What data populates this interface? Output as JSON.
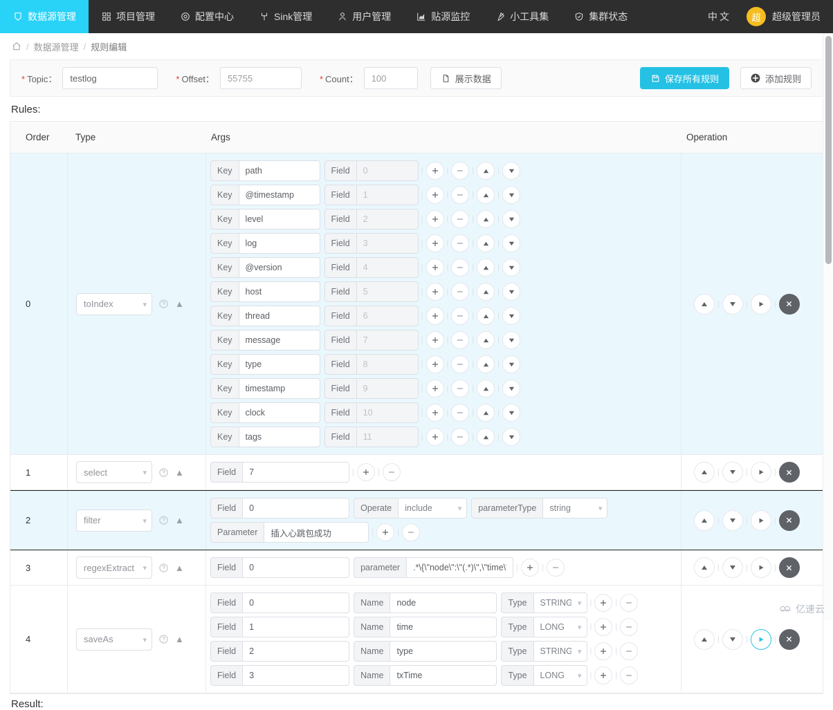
{
  "navbar": {
    "items": [
      {
        "label": "数据源管理",
        "icon": "database-icon",
        "active": true
      },
      {
        "label": "项目管理",
        "icon": "grid-icon",
        "active": false
      },
      {
        "label": "配置中心",
        "icon": "target-icon",
        "active": false
      },
      {
        "label": "Sink管理",
        "icon": "fork-icon",
        "active": false
      },
      {
        "label": "用户管理",
        "icon": "user-icon",
        "active": false
      },
      {
        "label": "贴源监控",
        "icon": "chart-icon",
        "active": false
      },
      {
        "label": "小工具集",
        "icon": "tool-icon",
        "active": false
      },
      {
        "label": "集群状态",
        "icon": "shield-check-icon",
        "active": false
      }
    ],
    "language": "中文",
    "avatar_text": "超",
    "user_name": "超级管理员",
    "accent_color": "#29d2f7",
    "avatar_color": "#f5bd1f"
  },
  "breadcrumb": {
    "home_icon": "home-icon",
    "items": [
      "数据源管理",
      "规则编辑"
    ],
    "separator": "/"
  },
  "filter_bar": {
    "topic_label": "Topic：",
    "topic_value": "testlog",
    "offset_label": "Offset：",
    "offset_value": "55755",
    "count_label": "Count：",
    "count_value": "100",
    "show_data_label": "展示数据",
    "show_data_icon": "document-icon",
    "save_all_label": "保存所有规则",
    "save_all_icon": "save-icon",
    "add_rule_label": "添加规则",
    "add_rule_icon": "plus-circle-icon"
  },
  "rules_section": {
    "title": "Rules:",
    "result_title": "Result:",
    "columns": [
      "Order",
      "Type",
      "Args",
      "Operation"
    ]
  },
  "labels": {
    "key": "Key",
    "field": "Field",
    "operate": "Operate",
    "parameter_type": "parameterType",
    "parameter_cap": "Parameter",
    "parameter_low": "parameter",
    "name": "Name",
    "type": "Type"
  },
  "rules": [
    {
      "order": "0",
      "type": "toIndex",
      "tint": true,
      "selected": false,
      "layout": "key-field",
      "pairs": [
        {
          "key": "path",
          "field": "0"
        },
        {
          "key": "@timestamp",
          "field": "1"
        },
        {
          "key": "level",
          "field": "2"
        },
        {
          "key": "log",
          "field": "3"
        },
        {
          "key": "@version",
          "field": "4"
        },
        {
          "key": "host",
          "field": "5"
        },
        {
          "key": "thread",
          "field": "6"
        },
        {
          "key": "message",
          "field": "7"
        },
        {
          "key": "type",
          "field": "8"
        },
        {
          "key": "timestamp",
          "field": "9"
        },
        {
          "key": "clock",
          "field": "10"
        },
        {
          "key": "tags",
          "field": "11"
        }
      ],
      "play_active": false
    },
    {
      "order": "1",
      "type": "select",
      "tint": false,
      "selected": false,
      "layout": "field-only",
      "field_value": "7",
      "play_active": false
    },
    {
      "order": "2",
      "type": "filter",
      "tint": true,
      "selected": true,
      "layout": "filter",
      "field_value": "0",
      "operate_value": "include",
      "parameter_type_value": "string",
      "parameter_value": "插入心跳包成功",
      "play_active": false
    },
    {
      "order": "3",
      "type": "regexExtract",
      "tint": false,
      "selected": false,
      "layout": "regex",
      "field_value": "0",
      "parameter_value": ".*\\{\\\"node\\\":\\\"(.*)\\\",\\\"time\\\":(.*",
      "play_active": false
    },
    {
      "order": "4",
      "type": "saveAs",
      "tint": false,
      "selected": false,
      "layout": "save-as",
      "rows": [
        {
          "field": "0",
          "name": "node",
          "type": "STRING"
        },
        {
          "field": "1",
          "name": "time",
          "type": "LONG"
        },
        {
          "field": "2",
          "name": "type",
          "type": "STRING"
        },
        {
          "field": "3",
          "name": "txTime",
          "type": "LONG"
        }
      ],
      "play_active": true
    }
  ],
  "op_buttons": {
    "move_up": "move-up-icon",
    "move_down": "move-down-icon",
    "run": "run-icon",
    "delete": "delete-icon"
  },
  "watermark": {
    "text": "亿速云",
    "icon": "cloud-icon"
  }
}
